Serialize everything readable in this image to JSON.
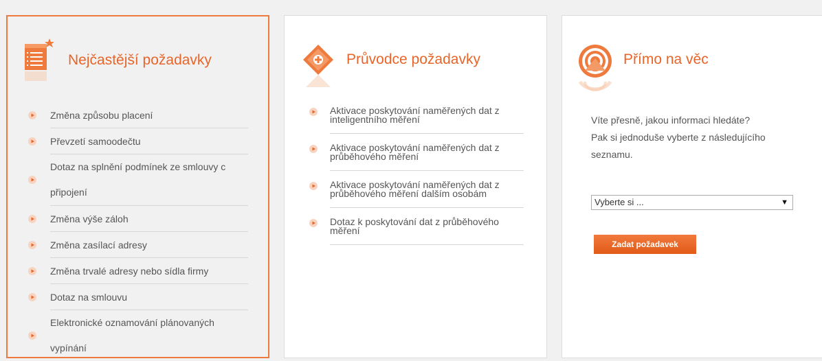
{
  "faq": {
    "title": "Nejčastější požadavky",
    "items": [
      {
        "label": "Změna způsobu placení"
      },
      {
        "label": "Převzetí samoodečtu"
      },
      {
        "label_line1": "Dotaz na splnění podmínek ze smlouvy c",
        "label_line2": "připojení"
      },
      {
        "label": "Změna výše záloh"
      },
      {
        "label": "Změna zasílací adresy"
      },
      {
        "label": "Změna trvalé adresy nebo sídla firmy"
      },
      {
        "label": "Dotaz na smlouvu"
      },
      {
        "label_line1": "Elektronické oznamování plánovaných",
        "label_line2": "vypínání"
      }
    ]
  },
  "guide": {
    "title": "Průvodce požadavky",
    "items": [
      {
        "label": "Aktivace poskytování naměřených dat z inteligentního měření"
      },
      {
        "label": "Aktivace poskytování naměřených dat z průběhového měření"
      },
      {
        "label": "Aktivace poskytování naměřených dat z průběhového měření dalším osobám"
      },
      {
        "label": "Dotaz k poskytování dat z průběhového měření"
      }
    ]
  },
  "direct": {
    "title": "Přímo na věc",
    "description_line1": "Víte přesně, jakou informaci hledáte?",
    "description_line2": "Pak si jednoduše vyberte z následujícího",
    "description_line3": "seznamu.",
    "select_value": "Vyberte si ...",
    "submit_label": "Zadat požadavek"
  },
  "colors": {
    "accent": "#e8652a",
    "panel_border": "#ee7a3e"
  }
}
